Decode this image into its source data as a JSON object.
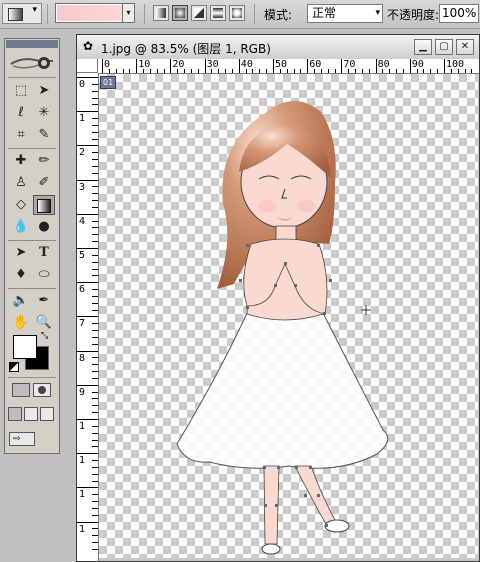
{
  "options_bar": {
    "mode_label": "模式:",
    "mode_value": "正常",
    "opacity_label": "不透明度:",
    "opacity_value": "100%",
    "gradient_color": "#f9c9c9"
  },
  "toolbox": {
    "foreground_color": "#ffffff",
    "background_color": "#000000",
    "tools": [
      "marquee-icon",
      "move-icon",
      "lasso-icon",
      "magic-wand-icon",
      "crop-icon",
      "slice-icon",
      "healing-brush-icon",
      "brush-icon",
      "clone-stamp-icon",
      "history-brush-icon",
      "eraser-icon",
      "gradient-icon",
      "blur-icon",
      "dodge-icon",
      "path-select-icon",
      "type-icon",
      "pen-icon",
      "shape-icon",
      "notes-icon",
      "eyedropper-icon",
      "hand-icon",
      "zoom-icon"
    ]
  },
  "document": {
    "title": "1.jpg @ 83.5% (图层 1, RGB)",
    "slice_label": "01",
    "ruler_h_labels": [
      "0",
      "10",
      "20",
      "30",
      "40",
      "50",
      "60",
      "70",
      "80",
      "90",
      "100"
    ],
    "ruler_v_labels": [
      "0",
      "1",
      "2",
      "3",
      "4",
      "5",
      "6",
      "7",
      "8",
      "9",
      "1",
      "1",
      "1",
      "1"
    ]
  }
}
